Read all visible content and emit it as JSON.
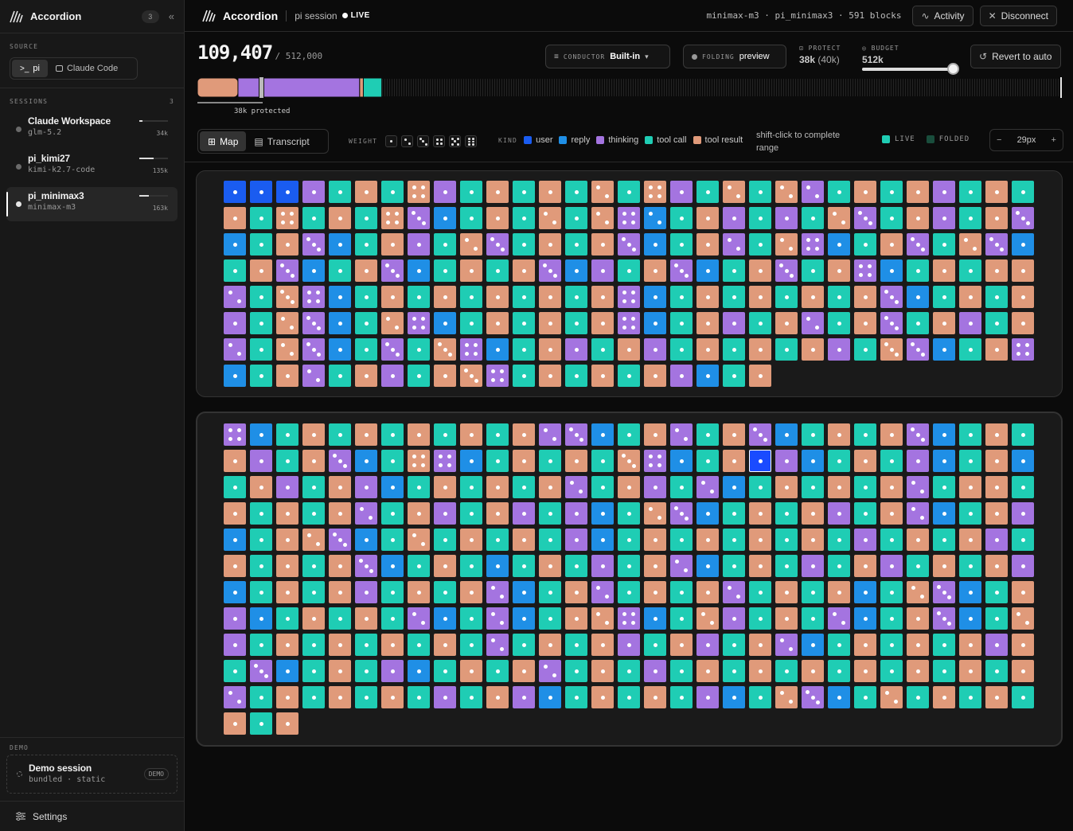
{
  "app": {
    "title": "Accordion",
    "session_count": "3"
  },
  "colors": {
    "user": "#1a5cf0",
    "reply": "#1f8fe6",
    "thinking": "#a474e0",
    "tool_call": "#1fcdb4",
    "tool_result": "#e09a7a",
    "live": "#1fcdb4",
    "folded": "#194d3c"
  },
  "sidebar": {
    "source_label": "SOURCE",
    "sources": [
      {
        "label": "pi",
        "icon": "terminal-icon",
        "active": true
      },
      {
        "label": "Claude Code",
        "icon": "chat-icon",
        "active": false
      }
    ],
    "sessions_label": "SESSIONS",
    "sessions_count": "3",
    "sessions": [
      {
        "name": "Claude Workspace",
        "model": "glm-5.2",
        "tokens": "34k",
        "usage": 0.1,
        "active": false
      },
      {
        "name": "pi_kimi27",
        "model": "kimi-k2.7-code",
        "tokens": "135k",
        "usage": 0.5,
        "active": false
      },
      {
        "name": "pi_minimax3",
        "model": "minimax-m3",
        "tokens": "163k",
        "usage": 0.33,
        "active": true
      }
    ],
    "demo_label": "DEMO",
    "demo": {
      "name": "Demo session",
      "meta": "bundled · static",
      "badge": "DEMO"
    },
    "settings": "Settings"
  },
  "topbar": {
    "title": "Accordion",
    "session": "pi session",
    "live": "LIVE",
    "meta": "minimax-m3 · pi_minimax3 · 591 blocks",
    "activity": "Activity",
    "disconnect": "Disconnect"
  },
  "context": {
    "tokens": "109,407",
    "limit": "/ 512,000",
    "used_tokens": 109407,
    "limit_tokens": 512000,
    "protected_tokens": 38000,
    "protected_label": "38k protected"
  },
  "controls": {
    "conductor_label": "CONDUCTOR",
    "conductor_value": "Built-in",
    "folding_label": "FOLDING",
    "folding_value": "preview",
    "protect_label": "PROTECT",
    "protect_value": "38k",
    "protect_sub": "(40k)",
    "budget_label": "BUDGET",
    "budget_value": "512k",
    "budget_fraction": 1.0,
    "revert": "Revert to auto"
  },
  "toolbar": {
    "map": "Map",
    "transcript": "Transcript",
    "weight_label": "WEIGHT",
    "kind_label": "KIND",
    "kinds": [
      {
        "label": "user",
        "key": "user"
      },
      {
        "label": "reply",
        "key": "reply"
      },
      {
        "label": "thinking",
        "key": "thinking"
      },
      {
        "label": "tool call",
        "key": "tool_call"
      },
      {
        "label": "tool result",
        "key": "tool_result"
      }
    ],
    "hint": "shift-click to complete range",
    "live_label": "LIVE",
    "folded_label": "FOLDED",
    "zoom": "29px"
  },
  "map": {
    "legend_codes": {
      "U": "user",
      "R": "reply",
      "T": "thinking",
      "C": "tool call",
      "S": "tool result",
      "X": "user (selected)"
    },
    "panels": [
      {
        "rows": [
          "U1U1U1T1C1S1C1S4T1C1S1C1S1C1S2C1S4T1C1S2C1S2T2C1S1C1S1T1C1S1C1",
          "S1C1S4C1S1C1S4T3R1C1S1C1S2C1S2T4R2C1S1T1C1T1C1S2T3C1S1T1C1S1",
          "T3R1C1S1T3R1C1S1T1C1S2T3C1S1C1S1T3R1C1S1T2C1S2T4R1C1S1T3C1S2T3",
          "R1C1S1T3R1C1S1T3R1C1S1C1S1T3R1T1C1S1T3R1C1S1T3C1S1T4R1C1S1C1S1",
          "S1T2C1S3T4R1C1S1C1S1C1S1C1S1C1S1T4R1C1S1C1S1C1S1C1S1T3R1C1S1C1",
          "S1T1C1S2T3R1C1S2T4R1C1S1C1S1C1S1T4R1C1S1T1C1S1T2C1S1T3C1S1T1C1",
          "S1T2C1S2T3R1C1T3C1S3T4R1C1S1T1C1S1T1C1S1C1S1C1S1T1C1S3T3R1C1",
          "S1T4R1C1S1T2C1S1T1C1S1S3T4C1S1C1S1C1S1T1R1C1S1"
        ]
      },
      {
        "rows": [
          "T4R1C1S1C1S1C1S1C1S1C1S1T2T3R1C1S1T2C1S1T3R1C1S1C1S1T3R1C1S1C1",
          "S1T1C1S1T3R1C1S4T4R1C1S1C1S1C1S3T4R1C1S1X1T1R1C1S1C1T1R1C1S1R1",
          "C1S1T1C1S1T1R1C1S1C1S1C1S1T2C1S1T1C1T2R1C1S1C1S1C1S1T2C1S1",
          "S1C1S1C1S1C1S1T2C1S1T1C1S1T1C1T1R1C1S2T3R1C1S1C1S1T1C1S1T2R1",
          "C1S1T1R1C1S1S2T3R1C1S2C1S1C1S1C1T1R1C1S1C1S1C1S1C1S1C1T1C1S1",
          "C1S1T1C1S1C1S1C1S1T3R1C1S1C1R1C1S1C1T1C1S1T2R1C1S1C1T1C1S1T1",
          "C1S1C1S1T1R1C1S1C1S1T1C1S1C1S1T2R1C1S1T2C1S1C1S1T2C1S1C1S1R1",
          "C1S2T3R1C1S1T1R1C1S1C1S1C1T2R1C1T2R1C1S1S2T4R1C1S2T1C1S1C1T2",
          "R1C1S1T3R1C1S2T1C1S1C1S1C1S1C1S1C1T2C1S1C1S1T1C1S1T1C1S1T2R1",
          "C1S1C1S1C1S1T1S1C1T3R1C1S1C1T1R1C1S1C1S1T2C1S1C1T1C1S1C1S1C1",
          "S1C1S1C1S1C1S1C1S1T2C1S1C1S1C1S1C1T1C1S1T1R1C1S1C1S1C1T1R1",
          "C1S2T3R1C1S2C1S1C1S1C1S1C1S1"
        ]
      }
    ]
  }
}
